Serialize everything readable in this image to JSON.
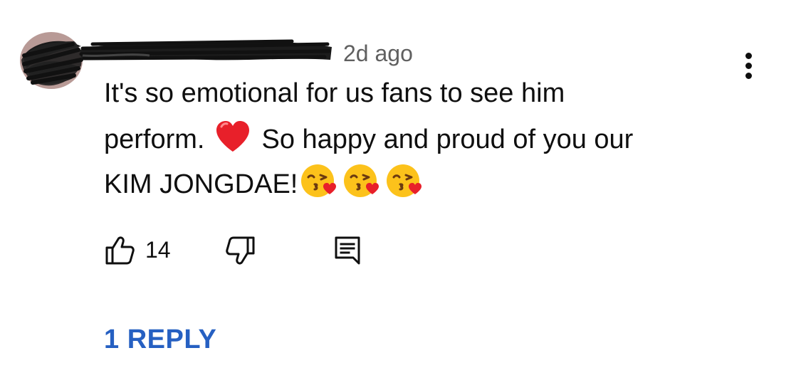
{
  "comment": {
    "timestamp": "2d ago",
    "text_line1": "It's so emotional for us fans to see him",
    "text_line2_a": "perform.",
    "text_line2_b": "So happy and proud of you our",
    "text_line3": "KIM JONGDAE!",
    "emojis": [
      "red-heart-emoji",
      "face-blowing-a-kiss-emoji",
      "face-blowing-a-kiss-emoji",
      "face-blowing-a-kiss-emoji"
    ]
  },
  "actions": {
    "like_count": "14",
    "like_icon": "thumbs-up-icon",
    "dislike_icon": "thumbs-down-icon",
    "reply_icon": "comment-icon",
    "more_icon": "vertical-ellipsis-icon"
  },
  "replies": {
    "label": "1 REPLY",
    "link_color": "#2660c2"
  }
}
